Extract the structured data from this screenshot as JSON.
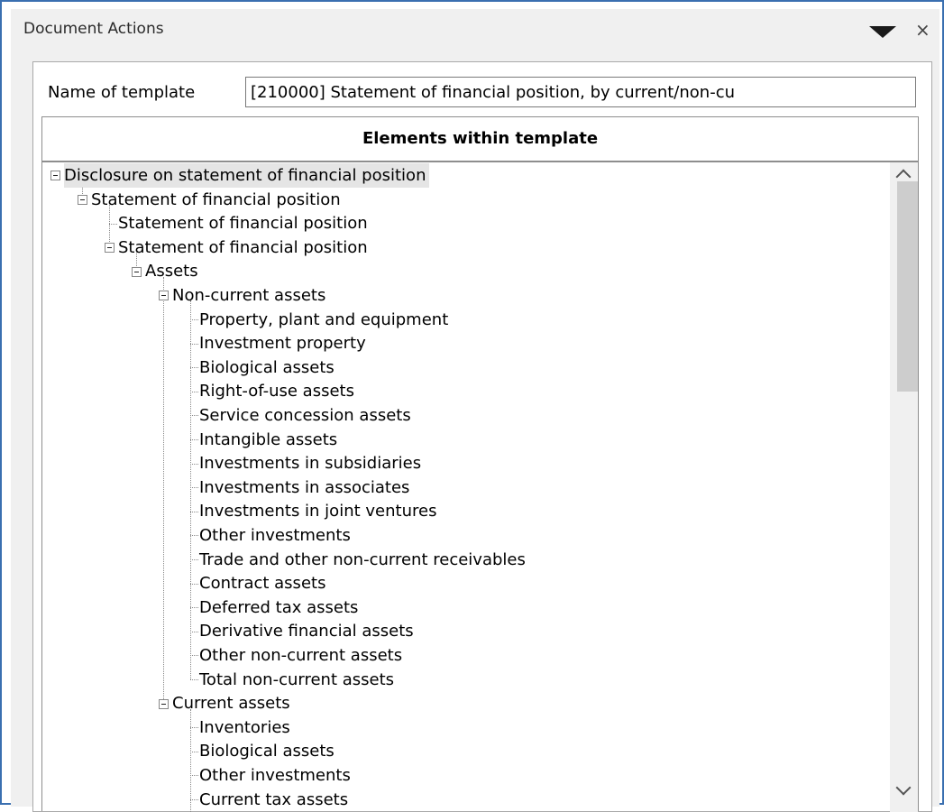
{
  "window": {
    "title": "Document Actions"
  },
  "template": {
    "name_label": "Name of template",
    "name_value": "[210000] Statement of financial position, by current/non-cu"
  },
  "grid": {
    "header": "Elements within template"
  },
  "tree": {
    "items": [
      {
        "label": "Disclosure on statement of financial position",
        "level": 0,
        "expanded": true,
        "selected": true
      },
      {
        "label": "Statement of financial position",
        "level": 1,
        "expanded": true
      },
      {
        "label": "Statement of financial position",
        "level": 2
      },
      {
        "label": "Statement of financial position",
        "level": 2,
        "expanded": true
      },
      {
        "label": "Assets",
        "level": 3,
        "expanded": true
      },
      {
        "label": "Non-current assets",
        "level": 4,
        "expanded": true
      },
      {
        "label": "Property, plant and equipment",
        "level": 5
      },
      {
        "label": "Investment property",
        "level": 5
      },
      {
        "label": "Biological assets",
        "level": 5
      },
      {
        "label": "Right-of-use assets",
        "level": 5
      },
      {
        "label": "Service concession assets",
        "level": 5
      },
      {
        "label": "Intangible assets",
        "level": 5
      },
      {
        "label": "Investments in subsidiaries",
        "level": 5
      },
      {
        "label": "Investments in associates",
        "level": 5
      },
      {
        "label": "Investments in joint ventures",
        "level": 5
      },
      {
        "label": "Other investments",
        "level": 5
      },
      {
        "label": "Trade and other non-current receivables",
        "level": 5
      },
      {
        "label": "Contract assets",
        "level": 5
      },
      {
        "label": "Deferred tax assets",
        "level": 5
      },
      {
        "label": "Derivative financial assets",
        "level": 5
      },
      {
        "label": "Other non-current assets",
        "level": 5
      },
      {
        "label": "Total non-current assets",
        "level": 5
      },
      {
        "label": "Current assets",
        "level": 4,
        "expanded": true
      },
      {
        "label": "Inventories",
        "level": 5
      },
      {
        "label": "Biological assets",
        "level": 5
      },
      {
        "label": "Other investments",
        "level": 5
      },
      {
        "label": "Current tax assets",
        "level": 5
      }
    ]
  },
  "scrollbar": {
    "position": 0
  },
  "icons": {
    "menu": "dropdown-triangle-icon",
    "close": "close-icon",
    "expander": "collapse-toggle-icon",
    "scroll_up": "scroll-up-icon",
    "scroll_down": "scroll-down-icon"
  }
}
